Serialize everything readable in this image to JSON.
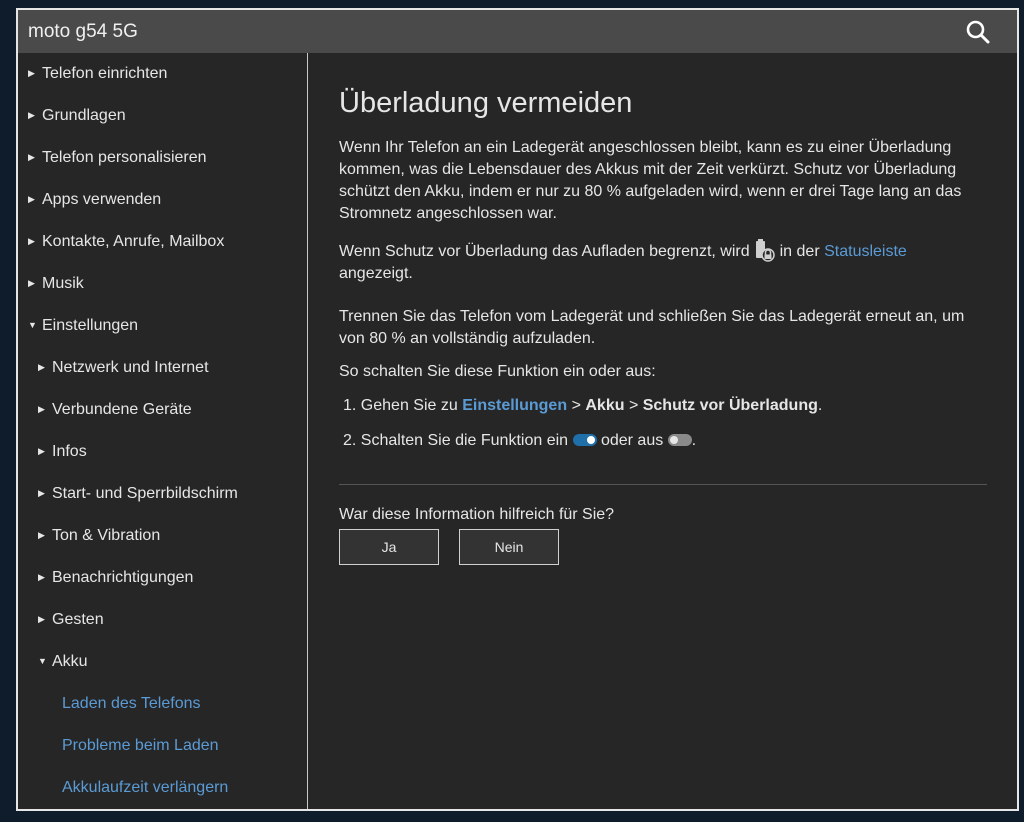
{
  "header": {
    "title": "moto g54 5G",
    "search_icon": "search-icon"
  },
  "sidebar": {
    "items": [
      {
        "label": "Telefon einrichten",
        "state": "collapsed"
      },
      {
        "label": "Grundlagen",
        "state": "collapsed"
      },
      {
        "label": "Telefon personalisieren",
        "state": "collapsed"
      },
      {
        "label": "Apps verwenden",
        "state": "collapsed"
      },
      {
        "label": "Kontakte, Anrufe, Mailbox",
        "state": "collapsed"
      },
      {
        "label": "Musik",
        "state": "collapsed"
      },
      {
        "label": "Einstellungen",
        "state": "expanded"
      },
      {
        "label": "Netzwerk und Internet",
        "state": "collapsed"
      },
      {
        "label": "Verbundene Geräte",
        "state": "collapsed"
      },
      {
        "label": "Infos",
        "state": "collapsed"
      },
      {
        "label": "Start- und Sperrbildschirm",
        "state": "collapsed"
      },
      {
        "label": "Ton & Vibration",
        "state": "collapsed"
      },
      {
        "label": "Benachrichtigungen",
        "state": "collapsed"
      },
      {
        "label": "Gesten",
        "state": "collapsed"
      },
      {
        "label": "Akku",
        "state": "expanded"
      },
      {
        "label": "Laden des Telefons",
        "state": "link"
      },
      {
        "label": "Probleme beim Laden",
        "state": "link"
      },
      {
        "label": "Akkulaufzeit verlängern",
        "state": "link"
      }
    ]
  },
  "article": {
    "title": "Überladung vermeiden",
    "p1": "Wenn Ihr Telefon an ein Ladegerät angeschlossen bleibt, kann es zu einer Überladung kommen, was die Lebensdauer des Akkus mit der Zeit verkürzt. Schutz vor Überladung schützt den Akku, indem er nur zu 80 % aufgeladen wird, wenn er drei Tage lang an das Stromnetz angeschlossen war.",
    "p2_before": "Wenn Schutz vor Überladung das Aufladen begrenzt, wird",
    "p2_middle": "in der",
    "p2_link": "Statusleiste",
    "p2_after": "angezeigt.",
    "p3": "Trennen Sie das Telefon vom Ladegerät und schließen Sie das Ladegerät erneut an, um von 80 % an vollständig aufzuladen.",
    "p4": "So schalten Sie diese Funktion ein oder aus:",
    "step1_num": "1.",
    "step1_prefix": "Gehen Sie zu",
    "step1_link": "Einstellungen",
    "step1_sep1": ">",
    "step1_b1": "Akku",
    "step1_sep2": ">",
    "step1_b2": "Schutz vor Überladung",
    "step1_end": ".",
    "step2_num": "2.",
    "step2_prefix": "Schalten Sie die Funktion ein",
    "step2_middle": "oder aus",
    "step2_end": "."
  },
  "feedback": {
    "question": "War diese Information hilfreich für Sie?",
    "yes_label": "Ja",
    "no_label": "Nein"
  },
  "colors": {
    "link": "#5b9bd5",
    "background": "#262626",
    "header": "#4a4a4a",
    "toggle_on": "#1f6fa8"
  }
}
